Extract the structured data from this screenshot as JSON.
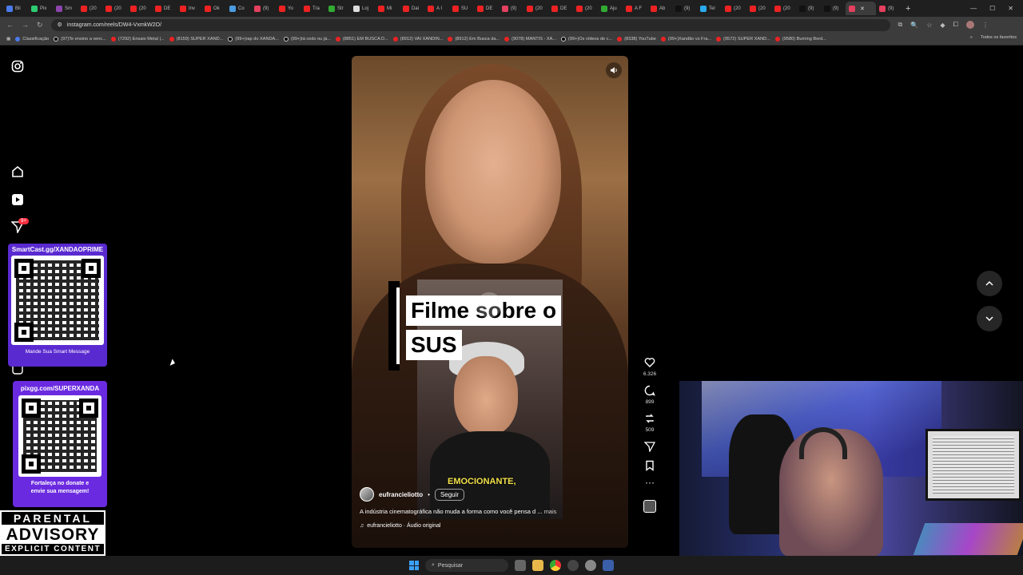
{
  "browser": {
    "tabs": [
      "Bli",
      "Pix",
      "Sm",
      "(20",
      "(20",
      "(20",
      "DE",
      "Inv",
      "Ok",
      "Co",
      "(9)",
      "Yo",
      "Tra",
      "Str",
      "Loj",
      "Mi",
      "Dai",
      "A I",
      "SU",
      "DE",
      "(9)",
      "(20",
      "DE",
      "(20",
      "Aju",
      "A F",
      "Ab",
      "(9)",
      "Tel",
      "(20",
      "(20",
      "(20",
      "(9)",
      "(9)",
      "",
      "(9)"
    ],
    "active_tab_index": 34,
    "url": "instagram.com/reels/DW4-VxmkW2O/",
    "bookmarks": [
      "Classificação",
      "(97)Te ensino a venc...",
      "(7292) Ensaio Metal |...",
      "(8159) SUPER XAND...",
      "(99+)rap do XANDÃ...",
      "(99+)tá cedo ou já...",
      "(8851) EM BUSCA D...",
      "(8912) VAI XANDIN...",
      "(8912) Em Busca da...",
      "(9078) MANTIS - XA...",
      "(99+)Os vídeos de c...",
      "(8338) YouTube",
      "(99+)Xandão vs Fra...",
      "(9572) SUPER XAND...",
      "(9580) Burning Bord..."
    ],
    "all_bookmarks": "Todos os favoritos"
  },
  "sidebar": {
    "notifications_badge": "9+"
  },
  "overlays": {
    "qr1_title": "SmartCast.gg/XANDAOPRIME",
    "qr1_footer": "Mande Sua Smart Message",
    "qr2_title": "pixgg.com/SUPERXANDA",
    "qr2_footer_line1": "Fortaleça no donate e",
    "qr2_footer_line2": "envie sua mensagem!",
    "advisory_line1": "PARENTAL",
    "advisory_line2": "ADVISORY",
    "advisory_line3": "EXPLICIT CONTENT"
  },
  "reel": {
    "title_line1": "Filme sobre o",
    "title_line2": "SUS",
    "burned_caption": "EMOCIONANTE,",
    "author": "eufrancieliotto",
    "follow_label": "Seguir",
    "description": "A indústria cinematográfica não muda a forma como você pensa d ...",
    "more_label": "mais",
    "audio": "eufrancieliotto · Áudio original"
  },
  "actions": {
    "likes": "6.326",
    "comments": "899",
    "reposts": "509"
  },
  "taskbar": {
    "search_placeholder": "Pesquisar"
  },
  "colors": {
    "overlay_purple": "#5a2ad1",
    "caption_yellow": "#f3e14a",
    "badge_red": "#ff3040"
  }
}
